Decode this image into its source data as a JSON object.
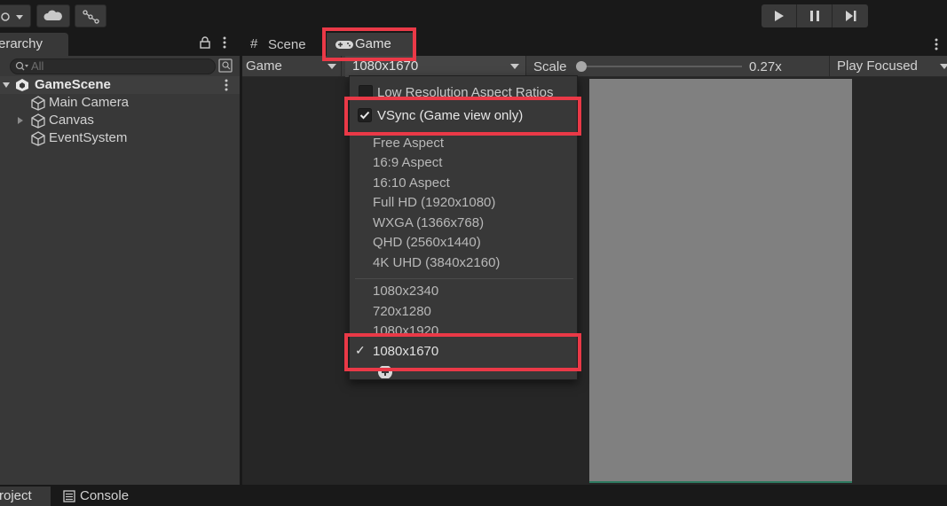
{
  "toolbar": {
    "icons": [
      "collab-icon",
      "cloud-icon",
      "services-icon"
    ],
    "play_controls": [
      "play-icon",
      "pause-icon",
      "step-icon"
    ]
  },
  "hierarchy": {
    "tab_label": "erarchy",
    "search_placeholder": "All",
    "scene": "GameScene",
    "items": [
      {
        "label": "Main Camera",
        "expandable": false
      },
      {
        "label": "Canvas",
        "expandable": true
      },
      {
        "label": "EventSystem",
        "expandable": false
      }
    ]
  },
  "view_tabs": {
    "scene": "Scene",
    "game": "Game"
  },
  "game_controls": {
    "display": "Game",
    "resolution": "1080x1670",
    "scale_label": "Scale",
    "scale_value": "0.27x",
    "scale_fraction": 0.0,
    "play_mode": "Play Focused"
  },
  "dropdown": {
    "low_res": "Low Resolution Aspect Ratios",
    "vsync": "VSync (Game view only)",
    "vsync_checked": true,
    "presets": [
      "Free Aspect",
      "16:9 Aspect",
      "16:10 Aspect",
      "Full HD (1920x1080)",
      "WXGA (1366x768)",
      "QHD (2560x1440)",
      "4K UHD (3840x2160)"
    ],
    "custom": [
      "1080x2340",
      "720x1280",
      "1080x1920",
      "1080x1670"
    ],
    "selected": "1080x1670"
  },
  "bottom_tabs": {
    "project": "roject",
    "console": "Console"
  },
  "colors": {
    "highlight": "#ea3947",
    "panel": "#383838",
    "canvas": "#808080"
  }
}
